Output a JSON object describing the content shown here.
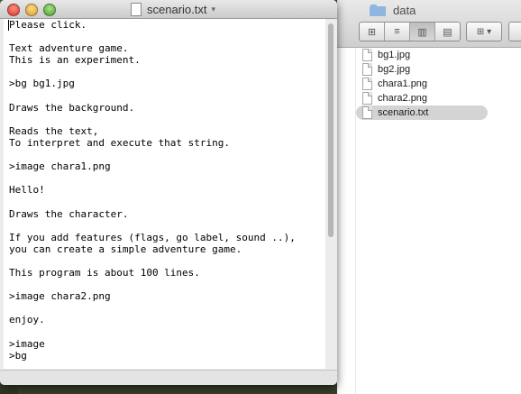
{
  "colors": {
    "selection": "#d4d4d4",
    "folder_icon": "#8fb6de",
    "close": "#d8382c",
    "minimize": "#d9a02a",
    "zoom": "#4e9d2c"
  },
  "editor": {
    "title": "scenario.txt",
    "title_caret": "▾",
    "icon": "text-document-icon",
    "lines": [
      "Please click.",
      "",
      "Text adventure game.",
      "This is an experiment.",
      "",
      ">bg bg1.jpg",
      "",
      "Draws the background.",
      "",
      "Reads the text,",
      "To interpret and execute that string.",
      "",
      ">image chara1.png",
      "",
      "Hello!",
      "",
      "Draws the character.",
      "",
      "If you add features (flags, go label, sound ..),",
      "you can create a simple adventure game.",
      "",
      "This program is about 100 lines.",
      "",
      ">image chara2.png",
      "",
      "enjoy.",
      "",
      ">image",
      ">bg"
    ]
  },
  "finder": {
    "folder_name": "data",
    "view_buttons": [
      {
        "icon": "icon-view-icon",
        "glyph": "⊞"
      },
      {
        "icon": "list-view-icon",
        "glyph": "≡"
      },
      {
        "icon": "column-view-icon",
        "glyph": "▥"
      },
      {
        "icon": "coverflow-view-icon",
        "glyph": "▤"
      }
    ],
    "arrange_glyph": "⊞ ▾",
    "files": [
      {
        "name": "bg1.jpg",
        "selected": false
      },
      {
        "name": "bg2.jpg",
        "selected": false
      },
      {
        "name": "chara1.png",
        "selected": false
      },
      {
        "name": "chara2.png",
        "selected": false
      },
      {
        "name": "scenario.txt",
        "selected": true
      }
    ]
  }
}
